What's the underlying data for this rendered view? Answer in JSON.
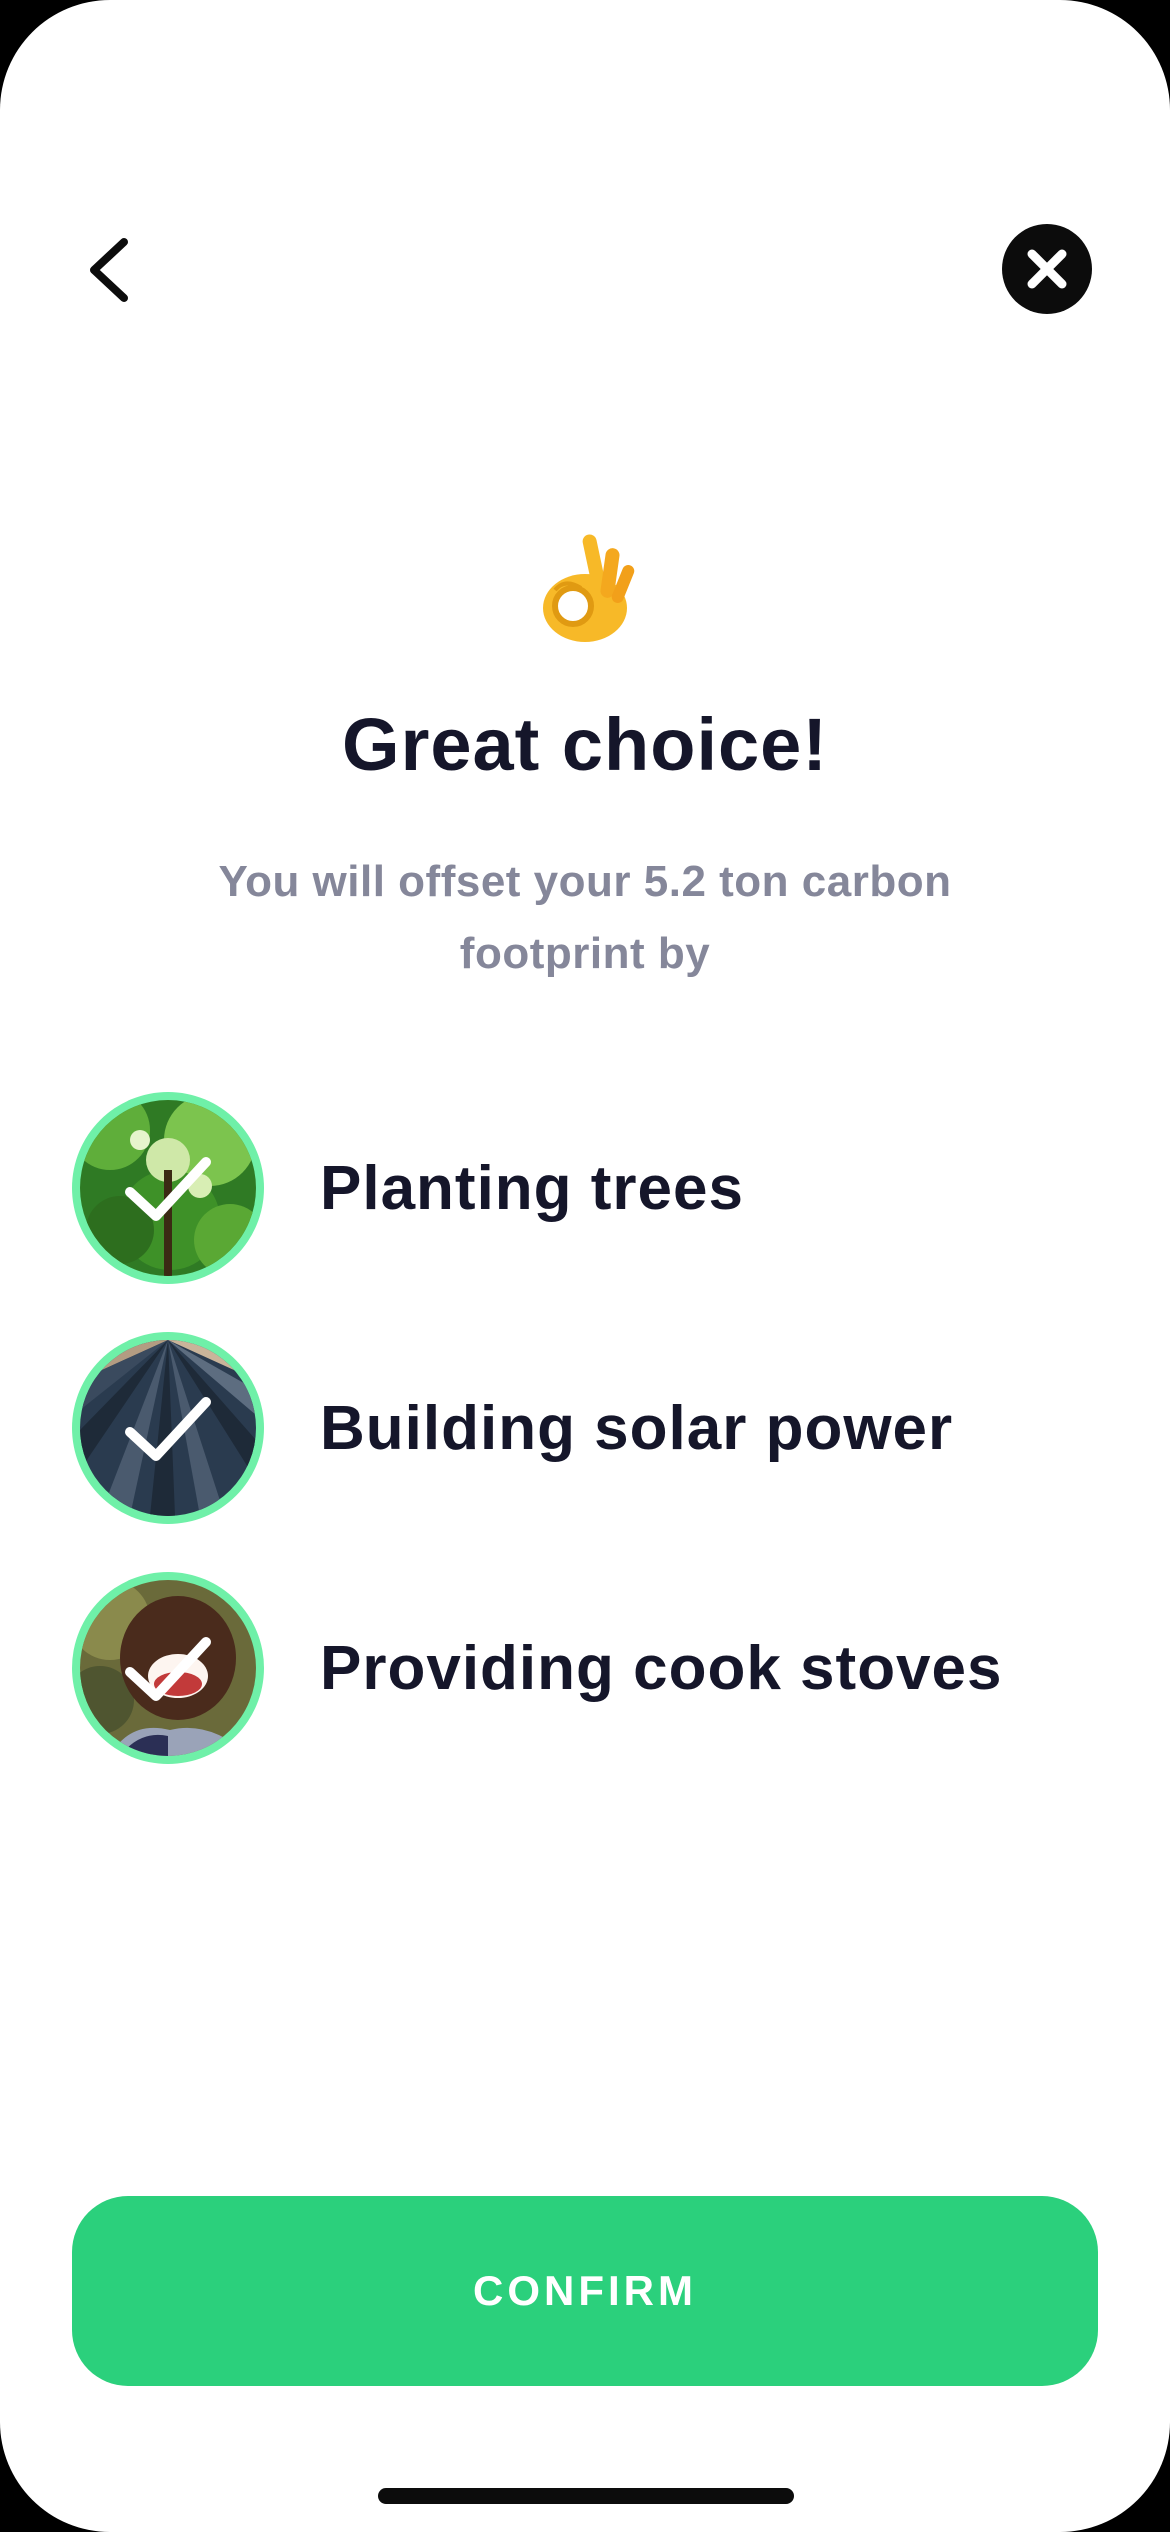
{
  "nav": {
    "back_icon": "chevron-left-icon",
    "close_icon": "close-icon"
  },
  "hero": {
    "emoji": "👌",
    "title": "Great choice!",
    "subtitle": "You will offset your 5.2 ton carbon footprint by"
  },
  "options": [
    {
      "label": "Planting trees",
      "image": "forest-canopy-photo",
      "checked": true
    },
    {
      "label": "Building solar power",
      "image": "solar-panels-photo",
      "checked": true
    },
    {
      "label": "Providing cook stoves",
      "image": "smiling-child-photo",
      "checked": true
    }
  ],
  "footer": {
    "confirm_label": "CONFIRM"
  },
  "colors": {
    "accent": "#2bd07c",
    "ring": "#6ff0a8",
    "text": "#15162a",
    "muted": "#85879a"
  }
}
